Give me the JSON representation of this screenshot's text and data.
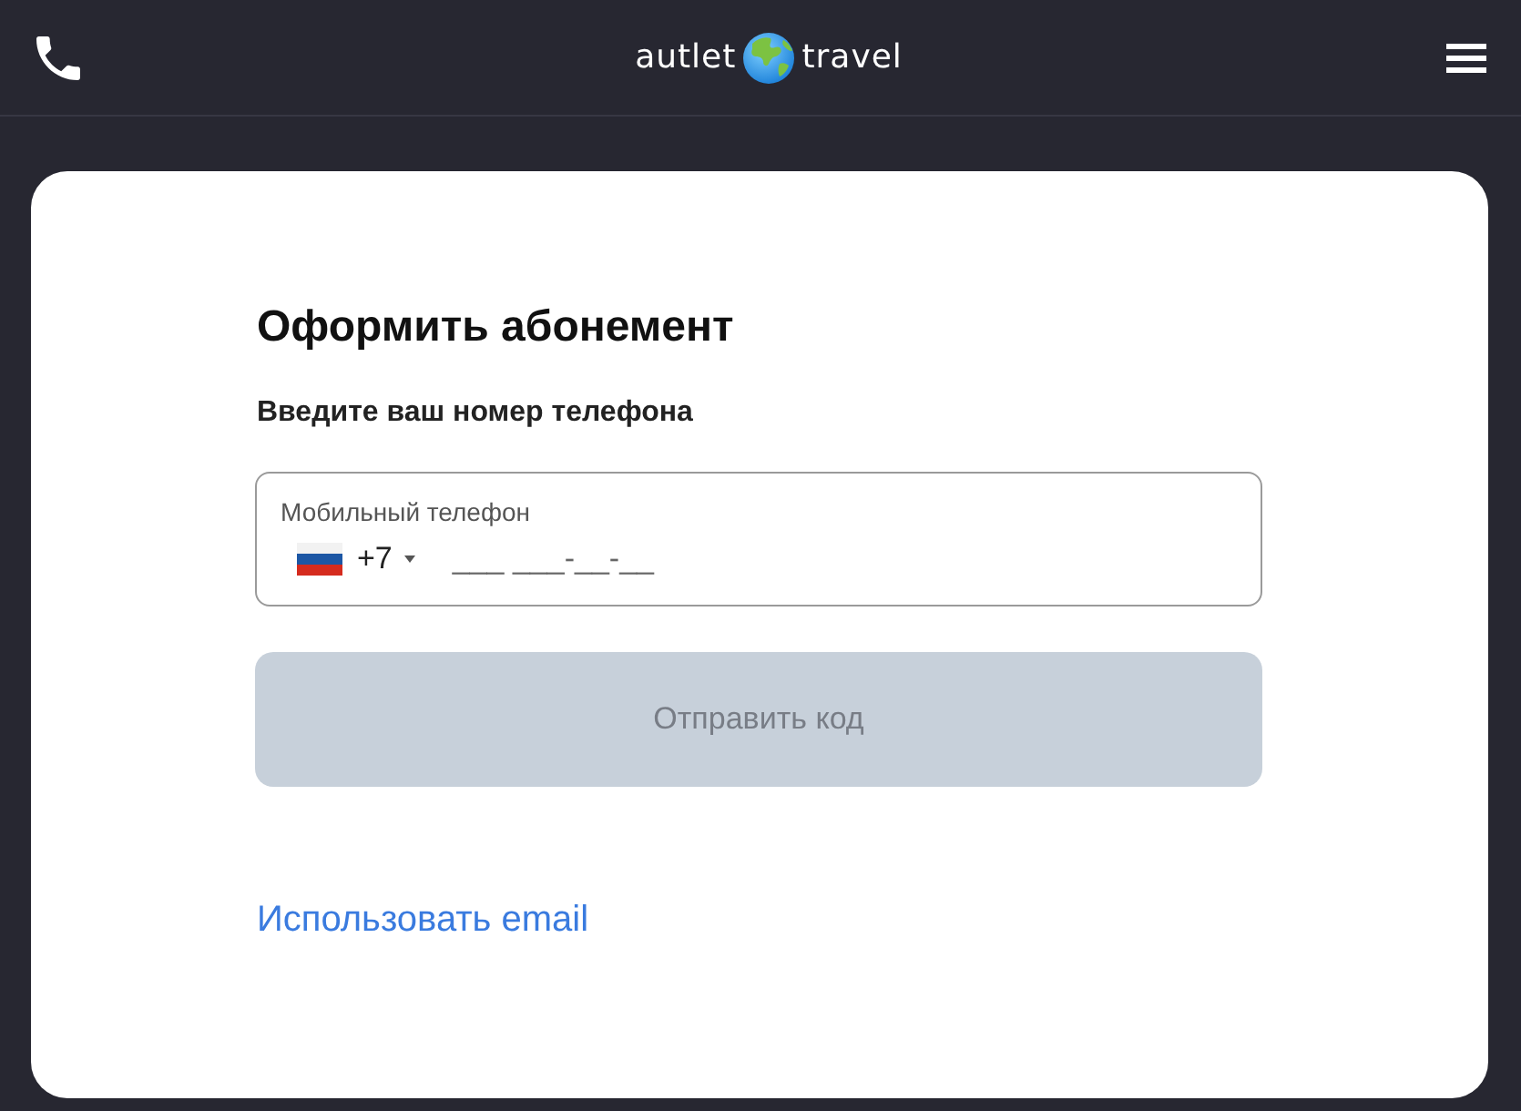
{
  "header": {
    "logo": {
      "left": "autlet",
      "right": "travel"
    }
  },
  "form": {
    "title": "Оформить абонемент",
    "subtitle": "Введите ваш номер телефона",
    "phone_field": {
      "label": "Мобильный телефон",
      "country_code": "+7",
      "placeholder": "___ ___-__-__"
    },
    "submit_button": {
      "label": "Отправить код",
      "disabled": true
    },
    "alt_link": "Использовать email"
  }
}
